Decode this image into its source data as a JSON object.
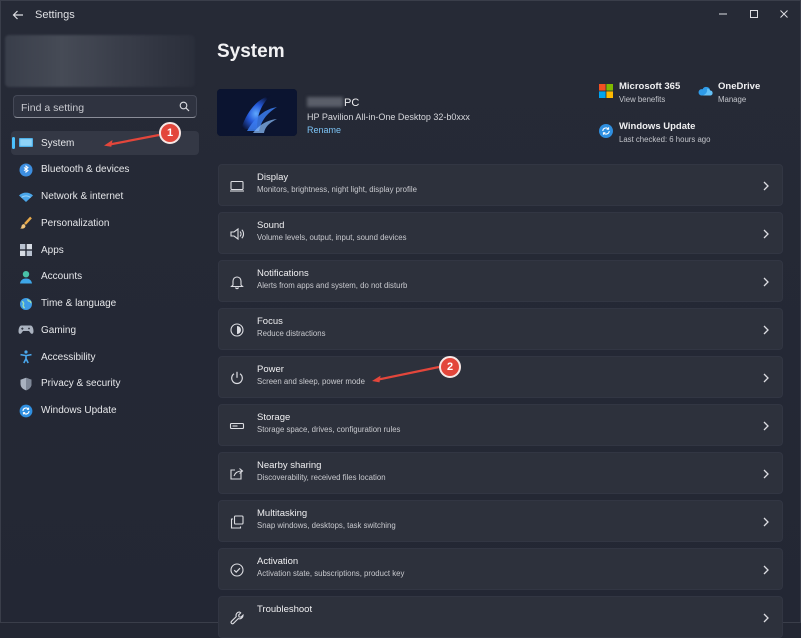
{
  "window": {
    "title": "Settings"
  },
  "search": {
    "placeholder": "Find a setting"
  },
  "sidebar": {
    "items": [
      {
        "label": "System",
        "icon": "system-icon"
      },
      {
        "label": "Bluetooth & devices",
        "icon": "bluetooth-icon"
      },
      {
        "label": "Network & internet",
        "icon": "wifi-icon"
      },
      {
        "label": "Personalization",
        "icon": "brush-icon"
      },
      {
        "label": "Apps",
        "icon": "apps-icon"
      },
      {
        "label": "Accounts",
        "icon": "accounts-icon"
      },
      {
        "label": "Time & language",
        "icon": "globe-icon"
      },
      {
        "label": "Gaming",
        "icon": "gamepad-icon"
      },
      {
        "label": "Accessibility",
        "icon": "accessibility-icon"
      },
      {
        "label": "Privacy & security",
        "icon": "shield-icon"
      },
      {
        "label": "Windows Update",
        "icon": "windows-update-icon"
      }
    ]
  },
  "main": {
    "title": "System",
    "device": {
      "name_suffix": "PC",
      "model": "HP Pavilion All-in-One Desktop 32-b0xxx",
      "rename": "Rename"
    },
    "tiles": [
      {
        "title": "Microsoft 365",
        "subtitle": "View benefits"
      },
      {
        "title": "OneDrive",
        "subtitle": "Manage"
      },
      {
        "title": "Windows Update",
        "subtitle": "Last checked: 6 hours ago"
      }
    ],
    "cards": [
      {
        "title": "Display",
        "subtitle": "Monitors, brightness, night light, display profile",
        "icon": "display-icon"
      },
      {
        "title": "Sound",
        "subtitle": "Volume levels, output, input, sound devices",
        "icon": "speaker-icon"
      },
      {
        "title": "Notifications",
        "subtitle": "Alerts from apps and system, do not disturb",
        "icon": "bell-icon"
      },
      {
        "title": "Focus",
        "subtitle": "Reduce distractions",
        "icon": "focus-icon"
      },
      {
        "title": "Power",
        "subtitle": "Screen and sleep, power mode",
        "icon": "power-icon"
      },
      {
        "title": "Storage",
        "subtitle": "Storage space, drives, configuration rules",
        "icon": "storage-icon"
      },
      {
        "title": "Nearby sharing",
        "subtitle": "Discoverability, received files location",
        "icon": "share-icon"
      },
      {
        "title": "Multitasking",
        "subtitle": "Snap windows, desktops, task switching",
        "icon": "multitasking-icon"
      },
      {
        "title": "Activation",
        "subtitle": "Activation state, subscriptions, product key",
        "icon": "activation-icon"
      },
      {
        "title": "Troubleshoot",
        "subtitle": "",
        "icon": "wrench-icon"
      }
    ]
  },
  "annotations": [
    {
      "label": "1"
    },
    {
      "label": "2"
    }
  ],
  "colors": {
    "accent": "#4cc2ff",
    "annotation": "#e3463b",
    "background": "#232733",
    "card": "#2d313c"
  }
}
